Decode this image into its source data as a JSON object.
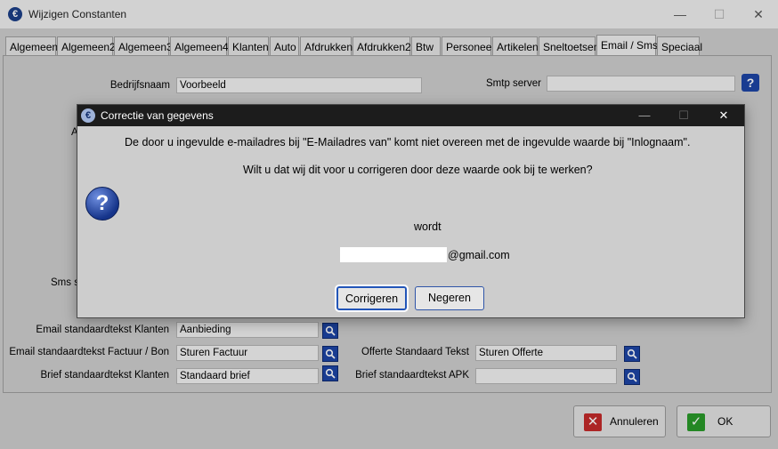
{
  "window": {
    "title": "Wijzigen Constanten"
  },
  "tabs": [
    "Algemeen",
    "Algemeen2",
    "Algemeen3",
    "Algemeen4",
    "Klanten",
    "Auto",
    "Afdrukken",
    "Afdrukken2",
    "Btw",
    "Personeel",
    "Artikelen",
    "Sneltoetsen",
    "Email / Sms",
    "Speciaal"
  ],
  "form": {
    "bedrijfsnaam_label": "Bedrijfsnaam",
    "bedrijfsnaam_value": "Voorbeeld",
    "smtp_label": "Smtp server",
    "smtp_value": "",
    "sms_label_partial": "Sms s",
    "a_label_partial": "A",
    "email_klanten_label": "Email standaardtekst Klanten",
    "email_klanten_value": "Aanbieding",
    "email_factuur_label": "Email standaardtekst Factuur / Bon",
    "email_factuur_value": "Sturen Factuur",
    "brief_klanten_label": "Brief standaardtekst Klanten",
    "brief_klanten_value": "Standaard brief",
    "offerte_label": "Offerte Standaard Tekst",
    "offerte_value": "Sturen Offerte",
    "brief_apk_label": "Brief standaardtekst APK",
    "brief_apk_value": ""
  },
  "buttons": {
    "annuleren": "Annuleren",
    "ok": "OK"
  },
  "dialog": {
    "title": "Correctie van gegevens",
    "line1": "De door u ingevulde e-mailadres bij \"E-Mailadres van\" komt niet overeen met de ingevulde waarde bij \"Inlognaam\".",
    "line2": "Wilt u dat wij dit voor u corrigeren door deze waarde ook bij te werken?",
    "wordt": "wordt",
    "email_suffix": "@gmail.com",
    "corrigeren": "Corrigeren",
    "negeren": "Negeren"
  }
}
